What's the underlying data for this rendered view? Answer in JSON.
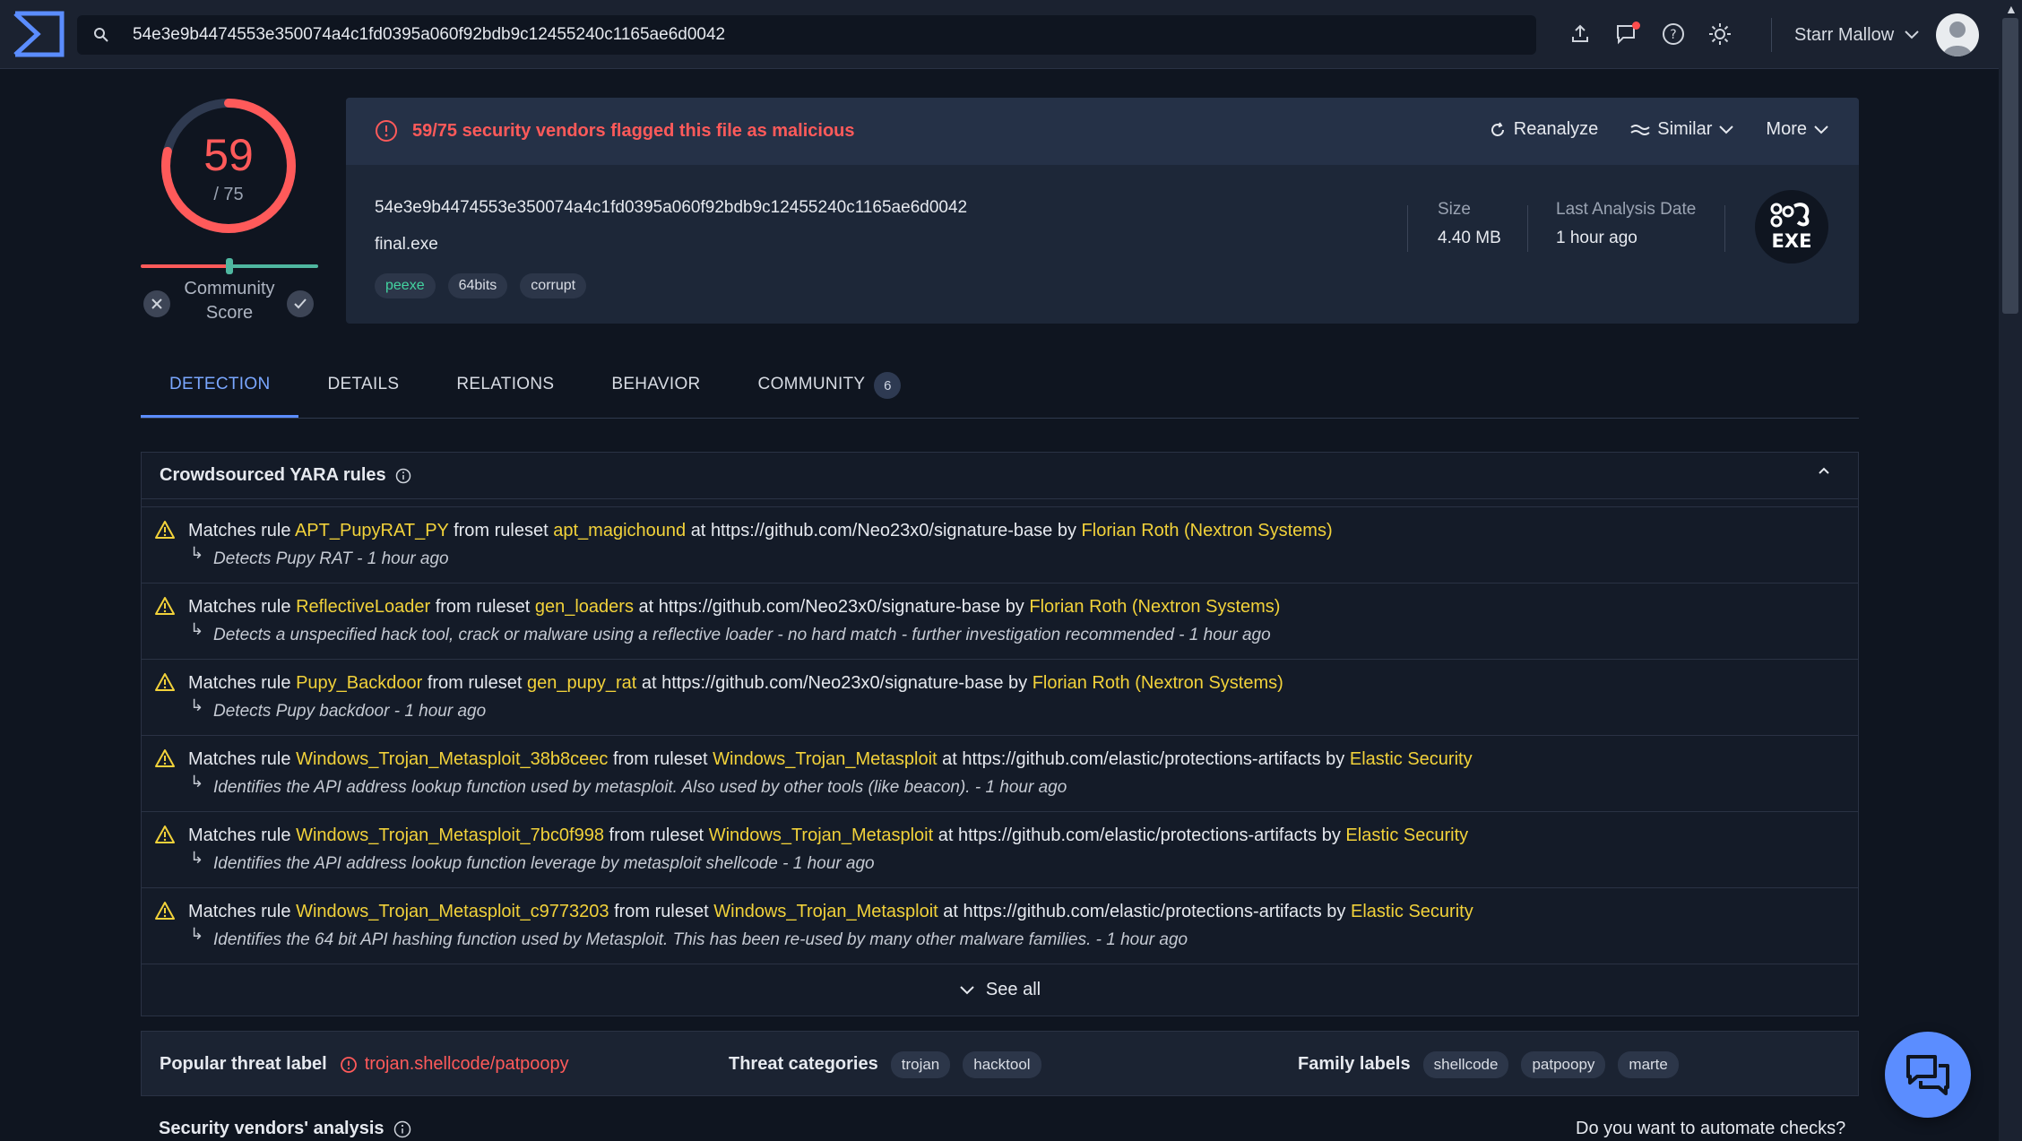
{
  "colors": {
    "accent": "#5b8dff",
    "danger": "#ff5a5a",
    "highlight": "#f2d23a",
    "success": "#4fb7a0",
    "background": "#0f1520"
  },
  "header": {
    "search_value": "54e3e9b4474553e350074a4c1fd0395a060f92bdb9c12455240c1165ae6d0042",
    "icons": [
      "upload-icon",
      "notification-icon",
      "help-icon",
      "theme-icon"
    ],
    "user_name": "Starr Mallow"
  },
  "score": {
    "detections": 59,
    "total_label": "/ 75",
    "community_label_line1": "Community",
    "community_label_line2": "Score"
  },
  "summary": {
    "alert": "59/75 security vendors flagged this file as malicious",
    "actions": [
      "Reanalyze",
      "Similar",
      "More"
    ],
    "hash": "54e3e9b4474553e350074a4c1fd0395a060f92bdb9c12455240c1165ae6d0042",
    "file_name": "final.exe",
    "tags": [
      "peexe",
      "64bits",
      "corrupt"
    ],
    "size_label": "Size",
    "size_value": "4.40 MB",
    "last_analysis_label": "Last Analysis Date",
    "last_analysis_value": "1 hour ago",
    "file_type": "EXE"
  },
  "tabs": [
    {
      "label": "DETECTION"
    },
    {
      "label": "DETAILS"
    },
    {
      "label": "RELATIONS"
    },
    {
      "label": "BEHAVIOR"
    },
    {
      "label": "COMMUNITY",
      "badge": "6"
    }
  ],
  "yara": {
    "title": "Crowdsourced YARA rules",
    "rules": [
      {
        "rule": "APT_PupyRAT_PY",
        "ruleset": "apt_magichound",
        "source": "https://github.com/Neo23x0/signature-base",
        "author": "Florian Roth (Nextron Systems)",
        "description": "Detects Pupy RAT - 1 hour ago"
      },
      {
        "rule": "ReflectiveLoader",
        "ruleset": "gen_loaders",
        "source": "https://github.com/Neo23x0/signature-base",
        "author": "Florian Roth (Nextron Systems)",
        "description": "Detects a unspecified hack tool, crack or malware using a reflective loader - no hard match - further investigation recommended - 1 hour ago"
      },
      {
        "rule": "Pupy_Backdoor",
        "ruleset": "gen_pupy_rat",
        "source": "https://github.com/Neo23x0/signature-base",
        "author": "Florian Roth (Nextron Systems)",
        "description": "Detects Pupy backdoor - 1 hour ago"
      },
      {
        "rule": "Windows_Trojan_Metasploit_38b8ceec",
        "ruleset": "Windows_Trojan_Metasploit",
        "source": "https://github.com/elastic/protections-artifacts",
        "author": "Elastic Security",
        "description": "Identifies the API address lookup function used by metasploit. Also used by other tools (like beacon). - 1 hour ago"
      },
      {
        "rule": "Windows_Trojan_Metasploit_7bc0f998",
        "ruleset": "Windows_Trojan_Metasploit",
        "source": "https://github.com/elastic/protections-artifacts",
        "author": "Elastic Security",
        "description": "Identifies the API address lookup function leverage by metasploit shellcode - 1 hour ago"
      },
      {
        "rule": "Windows_Trojan_Metasploit_c9773203",
        "ruleset": "Windows_Trojan_Metasploit",
        "source": "https://github.com/elastic/protections-artifacts",
        "author": "Elastic Security",
        "description": "Identifies the 64 bit API hashing function used by Metasploit. This has been re-used by many other malware families. - 1 hour ago"
      }
    ],
    "text_matches": "Matches rule",
    "text_from": "from ruleset",
    "text_at": "at",
    "text_by": "by",
    "see_all": "See all"
  },
  "threat": {
    "popular_label": "Popular threat label",
    "popular_value": "trojan.shellcode/patpoopy",
    "categories_label": "Threat categories",
    "categories": [
      "trojan",
      "hacktool"
    ],
    "family_label": "Family labels",
    "families": [
      "shellcode",
      "patpoopy",
      "marte"
    ]
  },
  "footer": {
    "vendors_title": "Security vendors' analysis",
    "automate": "Do you want to automate checks?"
  }
}
